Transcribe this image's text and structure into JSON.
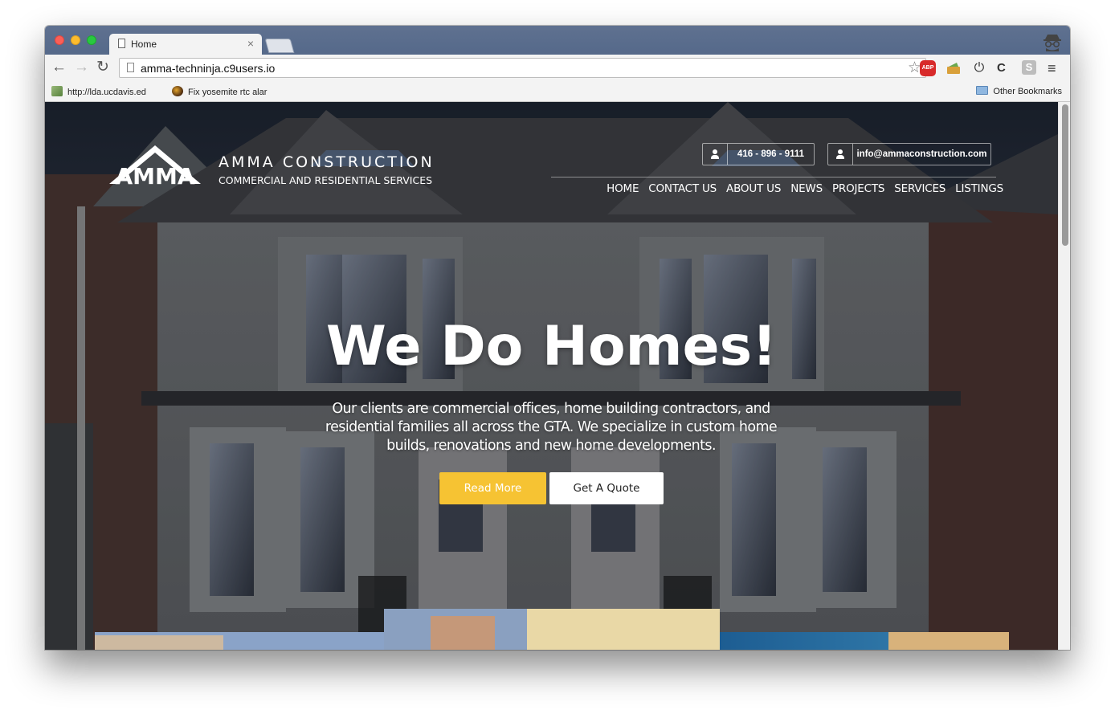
{
  "browser": {
    "tab_title": "Home",
    "tab_close": "×",
    "url": "amma-techninja.c9users.io",
    "bookmarks": [
      {
        "label": "http://lda.ucdavis.ed"
      },
      {
        "label": "Fix yosemite rtc alar"
      }
    ],
    "other_bookmarks": "Other Bookmarks",
    "extensions": {
      "abp": "ABP",
      "s": "S"
    }
  },
  "site": {
    "logo_text": "AMMA",
    "brand_name": "AMMA CONSTRUCTION",
    "brand_tagline": "COMMERCIAL AND RESIDENTIAL SERVICES",
    "phone": "416 - 896 - 9111",
    "email": "info@ammaconstruction.com",
    "nav": [
      "HOME",
      "CONTACT US",
      "ABOUT US",
      "NEWS",
      "PROJECTS",
      "SERVICES",
      "LISTINGS"
    ],
    "hero": {
      "title": "We Do Homes!",
      "text": "Our clients are commercial offices, home building contractors, and residential families all across the GTA. We specialize in custom home builds, renovations and new home developments.",
      "read_more": "Read More",
      "get_quote": "Get A Quote"
    },
    "colors": {
      "accent": "#f6c333",
      "tabstrip": "#5a6d8e"
    }
  }
}
